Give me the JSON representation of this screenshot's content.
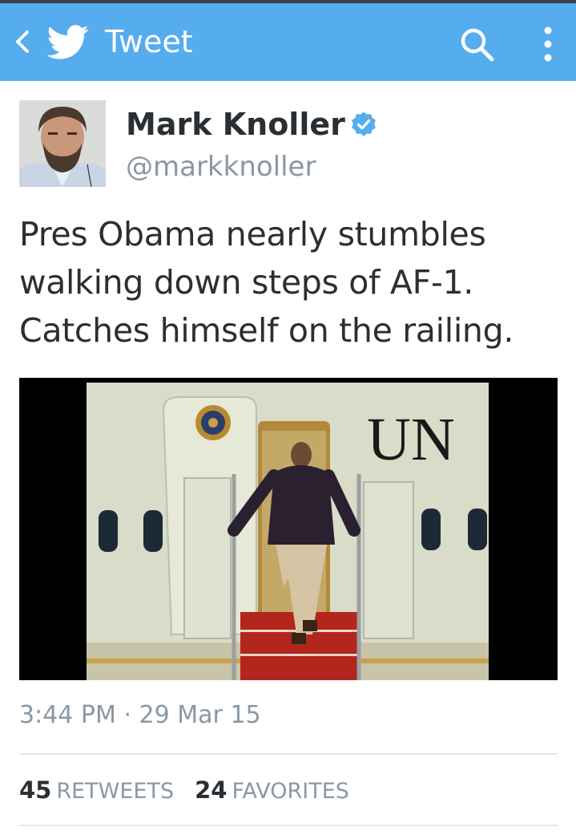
{
  "appbar": {
    "title": "Tweet",
    "back_icon": "chevron-left-icon",
    "logo_icon": "twitter-bird-icon",
    "search_icon": "search-icon",
    "overflow_icon": "more-vertical-icon",
    "color": "#55acee"
  },
  "tweet": {
    "author_name": "Mark Knoller",
    "author_handle": "@markknoller",
    "verified": true,
    "text_lines": [
      "Pres Obama nearly stumbles",
      "walking down steps of AF-1.",
      "Catches himself on the railing."
    ],
    "media_lettering": "UN",
    "time": "3:44 PM",
    "separator": "·",
    "date": "29 Mar 15"
  },
  "stats": {
    "retweets_count": "45",
    "retweets_label": "RETWEETS",
    "favorites_count": "24",
    "favorites_label": "FAVORITES"
  },
  "colors": {
    "text": "#292f33",
    "secondary": "#8899a6",
    "verified": "#55acee",
    "divider": "#e1e8ed"
  }
}
